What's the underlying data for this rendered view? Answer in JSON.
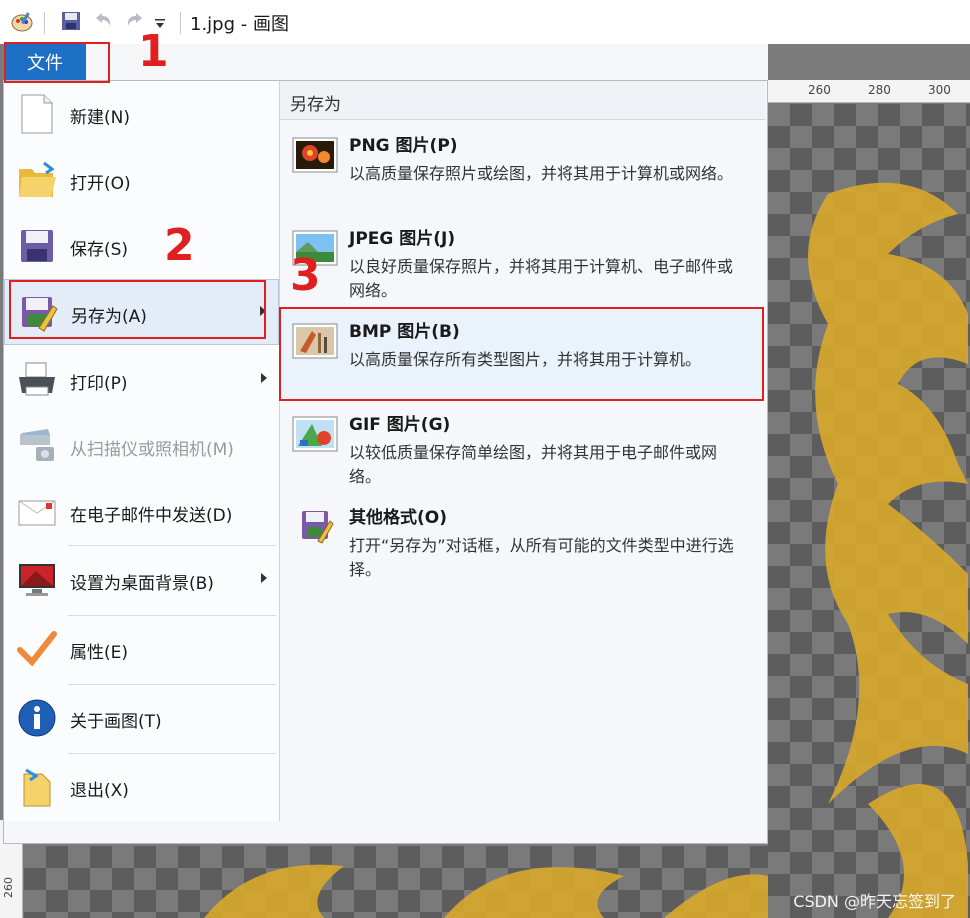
{
  "window": {
    "title": "1.jpg - 画图"
  },
  "file_tab": {
    "label": "文件"
  },
  "ruler": {
    "ticks": [
      "260",
      "280",
      "300"
    ],
    "left_tick": "260"
  },
  "menu": {
    "items": [
      {
        "label": "新建(N)",
        "icon": "new-file-icon"
      },
      {
        "label": "打开(O)",
        "icon": "open-folder-icon"
      },
      {
        "label": "保存(S)",
        "icon": "save-disk-icon"
      },
      {
        "label": "另存为(A)",
        "icon": "save-as-icon",
        "has_submenu": true,
        "active": true
      },
      {
        "label": "打印(P)",
        "icon": "printer-icon",
        "has_submenu": true
      },
      {
        "label": "从扫描仪或照相机(M)",
        "icon": "scanner-icon",
        "disabled": true
      },
      {
        "label": "在电子邮件中发送(D)",
        "icon": "email-icon"
      },
      {
        "label": "设置为桌面背景(B)",
        "icon": "desktop-background-icon",
        "has_submenu": true
      },
      {
        "label": "属性(E)",
        "icon": "checkmark-icon"
      },
      {
        "label": "关于画图(T)",
        "icon": "info-icon"
      },
      {
        "label": "退出(X)",
        "icon": "exit-icon"
      }
    ]
  },
  "save_as": {
    "header": "另存为",
    "options": [
      {
        "title": "PNG 图片(P)",
        "desc": "以高质量保存照片或绘图，并将其用于计算机或网络。",
        "icon": "png-image-icon"
      },
      {
        "title": "JPEG 图片(J)",
        "desc": "以良好质量保存照片，并将其用于计算机、电子邮件或网络。",
        "icon": "jpeg-image-icon"
      },
      {
        "title": "BMP 图片(B)",
        "desc": "以高质量保存所有类型图片，并将其用于计算机。",
        "icon": "bmp-image-icon",
        "highlighted": true
      },
      {
        "title": "GIF 图片(G)",
        "desc": "以较低质量保存简单绘图，并将其用于电子邮件或网络。",
        "icon": "gif-image-icon"
      },
      {
        "title": "其他格式(O)",
        "desc": "打开“另存为”对话框，从所有可能的文件类型中进行选择。",
        "icon": "other-formats-icon"
      }
    ]
  },
  "annotations": [
    "1",
    "2",
    "3"
  ],
  "watermark": "CSDN @昨天忘签到了",
  "colors": {
    "accent": "#1d6fc5",
    "annotation": "#e02020"
  }
}
